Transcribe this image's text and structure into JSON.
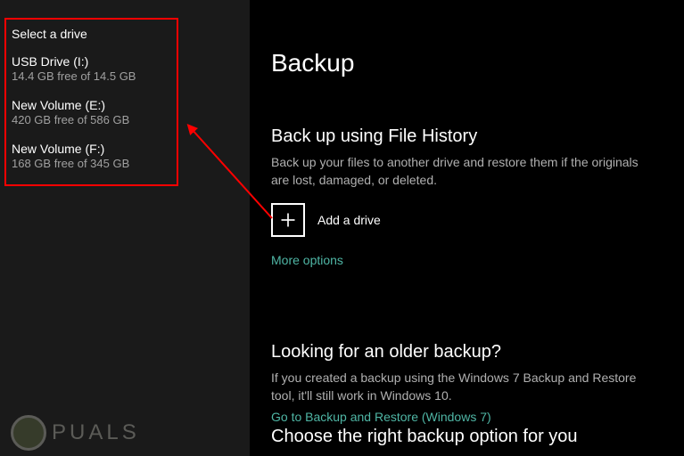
{
  "colors": {
    "highlight_border": "#ff0000",
    "link": "#4fb6a5"
  },
  "drive_selector": {
    "title": "Select a drive",
    "drives": [
      {
        "name": "USB Drive (I:)",
        "free": "14.4 GB free of 14.5 GB"
      },
      {
        "name": "New Volume (E:)",
        "free": "420 GB free of 586 GB"
      },
      {
        "name": "New Volume (F:)",
        "free": "168 GB free of 345 GB"
      }
    ]
  },
  "main": {
    "title": "Backup",
    "file_history": {
      "heading": "Back up using File History",
      "desc": "Back up your files to another drive and restore them if the originals are lost, damaged, or deleted.",
      "add_drive_label": "Add a drive",
      "more_options": "More options"
    },
    "older_backup": {
      "heading": "Looking for an older backup?",
      "desc": "If you created a backup using the Windows 7 Backup and Restore tool, it'll still work in Windows 10.",
      "link": "Go to Backup and Restore (Windows 7)"
    },
    "choose_option": {
      "heading": "Choose the right backup option for you"
    }
  },
  "watermark": {
    "text": "PUALS"
  }
}
